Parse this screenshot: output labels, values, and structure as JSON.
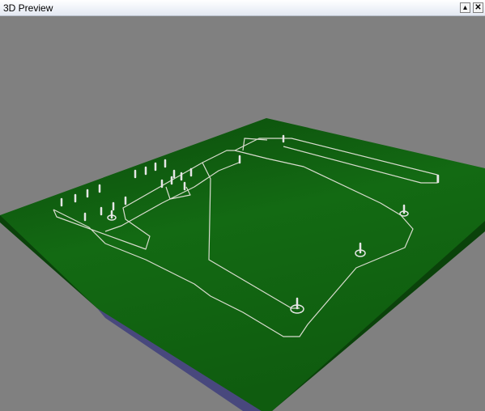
{
  "window": {
    "title": "3D Preview",
    "minimize_glyph": "▴",
    "close_glyph": "✕"
  },
  "scene": {
    "background_color": "#808080",
    "board_color": "#0f5a0f",
    "board_side_color": "#0c4a0c",
    "trace_color": "#d9dccf",
    "pin_color": "#e6e6e6"
  }
}
